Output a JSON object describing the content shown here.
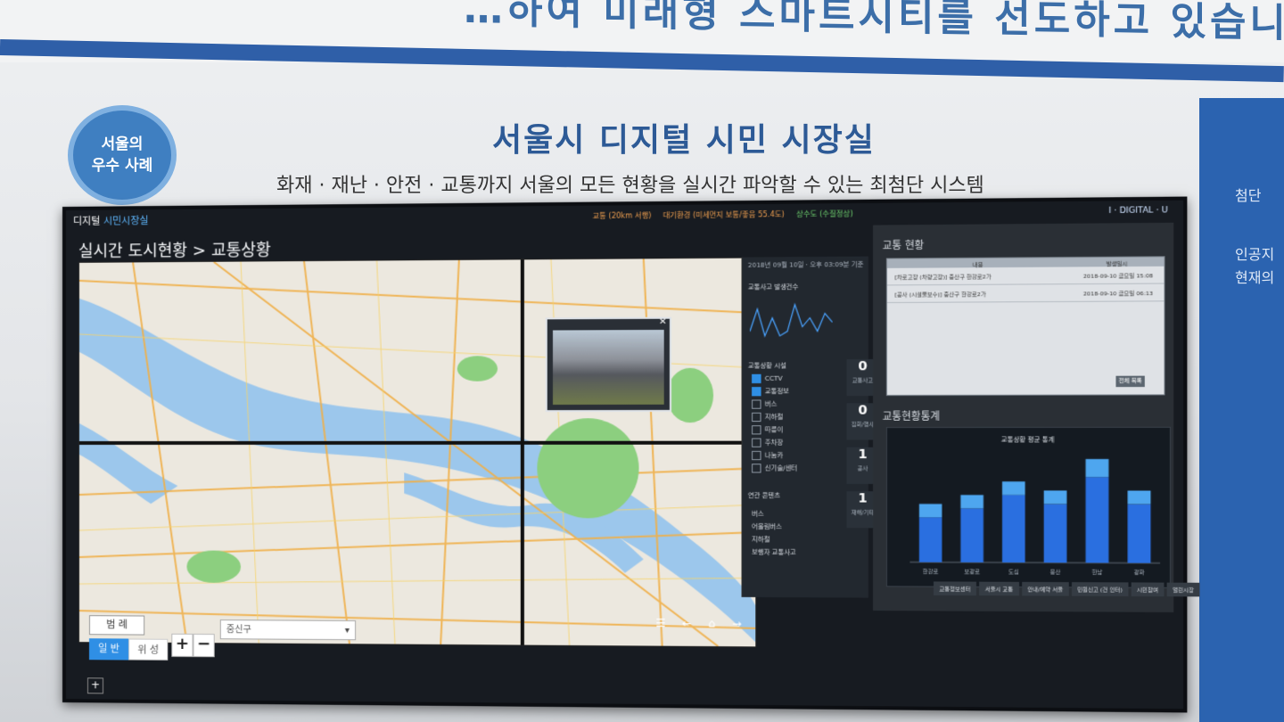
{
  "wall": {
    "slogan": "…하여 미래형 스마트시티를 선도하고 있습니",
    "badge_line1": "서울의",
    "badge_line2": "우수 사례",
    "title": "서울시 디지털 시민 시장실",
    "subtitle": "화재 · 재난 · 안전 · 교통까지 서울의 모든 현황을 실시간 파악할 수 있는 최첨단 시스템",
    "right_text1": "첨단",
    "right_text2": "인공지",
    "right_text3": "현재의"
  },
  "screen": {
    "brand_part1": "디지털",
    "brand_part2": "시민시장실",
    "legend": [
      "교통 (20km 서행)",
      "대기환경 (미세먼지 보통/좋음 55.4도)",
      "상수도 (수질정상)"
    ],
    "digital_u": "I · DIGITAL · U",
    "breadcrumb": "실시간 도시현황 > 교통상황",
    "map": {
      "legend_button": "범 례",
      "general_button": "일 반",
      "satellite_button": "위 성",
      "zoom_in": "+",
      "zoom_out": "−",
      "district_select": "중신구"
    },
    "side": {
      "date": "2018년 09월 10일 · 오후 03:09분 기준",
      "accidents_title": "교통사고 발생건수",
      "facilities_title": "교통상황 시설",
      "layers": [
        {
          "label": "CCTV",
          "checked": true
        },
        {
          "label": "교통정보",
          "checked": true
        },
        {
          "label": "버스",
          "checked": false
        },
        {
          "label": "지하철",
          "checked": false
        },
        {
          "label": "따릉이",
          "checked": false
        },
        {
          "label": "주차장",
          "checked": false
        },
        {
          "label": "나눔카",
          "checked": false
        },
        {
          "label": "신기술/센터",
          "checked": false
        }
      ],
      "related_title": "연관 콘텐츠",
      "related": [
        "버스",
        "어울림버스",
        "지하철",
        "보행자 교통사고"
      ],
      "counts": [
        {
          "value": "0",
          "label": "교통사고"
        },
        {
          "value": "0",
          "label": "집회/행사"
        },
        {
          "value": "1",
          "label": "공사"
        },
        {
          "value": "1",
          "label": "재해/기타"
        }
      ]
    },
    "traffic_status": {
      "title": "교통 현황",
      "col1": "내용",
      "col2": "발생일시",
      "rows": [
        {
          "content": "[차로고장 (차량고장)] 중산구 한강로2가",
          "time": "2018-09-10 금요일 15:08"
        },
        {
          "content": "[공사 (시설물보수)] 중산구 한강로2가",
          "time": "2018-09-10 금요일 06:13"
        }
      ],
      "more_button": "전체 목록"
    },
    "stats": {
      "title": "교통현황통계",
      "chart_title": "교통상황 평균 통계"
    },
    "footer_buttons": [
      "교통정보센터",
      "서울시 교통",
      "안내/예약 서울",
      "민원신고 (건 인터)",
      "시민참여",
      "열린시장"
    ]
  },
  "chart_data": {
    "type": "bar",
    "title": "교통상황 평균 통계",
    "categories": [
      "한강로",
      "보광로",
      "도심",
      "용산",
      "한남",
      "광화"
    ],
    "series": [
      {
        "values": [
          10,
          12,
          15,
          13,
          19,
          13
        ]
      },
      {
        "values": [
          3,
          3,
          3,
          3,
          4,
          3
        ]
      }
    ],
    "ylim": [
      0,
      25
    ],
    "colors": [
      "#2a6fe0",
      "#4ea6ef"
    ]
  },
  "side_spark": [
    3,
    8,
    2,
    6,
    2,
    3,
    9,
    4,
    6,
    3,
    7,
    5
  ]
}
